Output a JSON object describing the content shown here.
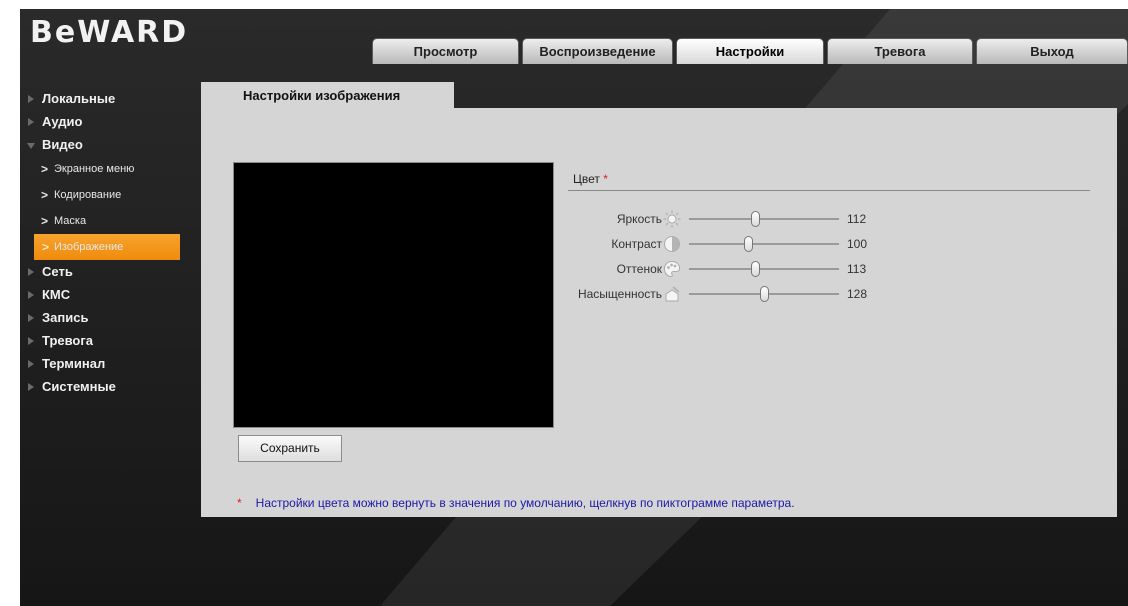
{
  "brand": {
    "logo_text": "BeWARD"
  },
  "tabs": [
    {
      "label": "Просмотр",
      "active": false
    },
    {
      "label": "Воспроизведение",
      "active": false
    },
    {
      "label": "Настройки",
      "active": true
    },
    {
      "label": "Тревога",
      "active": false
    },
    {
      "label": "Выход",
      "active": false
    }
  ],
  "sidebar": {
    "items": [
      {
        "label": "Локальные"
      },
      {
        "label": "Аудио"
      },
      {
        "label": "Видео",
        "expanded": true
      },
      {
        "label": "Экранное меню"
      },
      {
        "label": "Кодирование"
      },
      {
        "label": "Маска"
      },
      {
        "label": "Изображение",
        "active": true
      },
      {
        "label": "Сеть"
      },
      {
        "label": "КМС"
      },
      {
        "label": "Запись"
      },
      {
        "label": "Тревога"
      },
      {
        "label": "Терминал"
      },
      {
        "label": "Системные"
      }
    ]
  },
  "panel": {
    "tab_label": "Настройки изображения",
    "section_title": "Цвет",
    "required_mark": "*",
    "sliders": [
      {
        "label": "Яркость",
        "icon": "brightness-icon",
        "value": "112",
        "level": 0.44
      },
      {
        "label": "Контраст",
        "icon": "contrast-icon",
        "value": "100",
        "level": 0.39
      },
      {
        "label": "Оттенок",
        "icon": "hue-icon",
        "value": "113",
        "level": 0.44
      },
      {
        "label": "Насыщенность",
        "icon": "saturation-icon",
        "value": "128",
        "level": 0.5
      }
    ],
    "save_label": "Сохранить",
    "note_mark": "*",
    "note_text": "Настройки цвета можно вернуть в значения по умолчанию, щелкнув по пиктограмме параметра."
  },
  "colors": {
    "accent": "#f39a1e",
    "background": "#1c1c1c",
    "panel": "#d5d5d5",
    "note": "#1a1aa8",
    "required": "#e01e1e"
  }
}
